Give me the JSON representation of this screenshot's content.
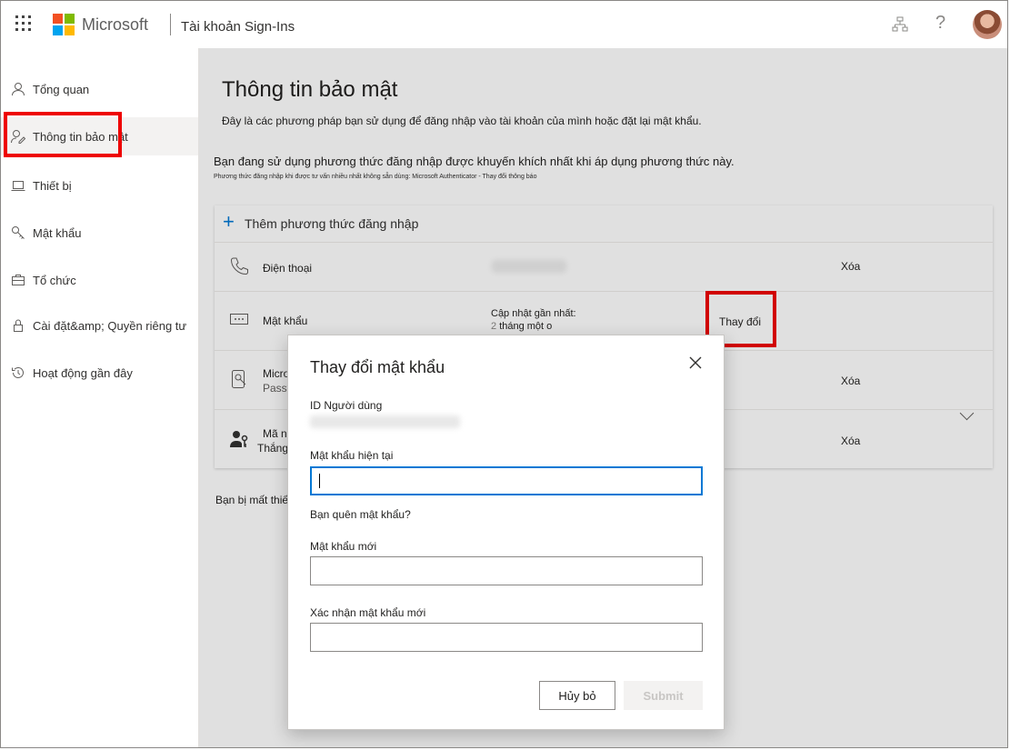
{
  "header": {
    "brand": "Microsoft",
    "app_title": "Tài khoản Sign-Ins",
    "help": "?"
  },
  "sidebar": {
    "items": [
      {
        "label": "Tổng quan",
        "icon": "person-icon"
      },
      {
        "label": "Thông tin bảo mật",
        "icon": "security-info-icon",
        "active": true
      },
      {
        "label": "Thiết bị",
        "icon": "laptop-icon"
      },
      {
        "label": "Mật khẩu",
        "icon": "key-icon"
      },
      {
        "label": "Tổ chức",
        "icon": "briefcase-icon"
      },
      {
        "label": "Cài đặt&amp; Quyền riêng tư",
        "icon": "lock-icon"
      },
      {
        "label": "Hoạt động gần đây",
        "icon": "history-icon"
      }
    ]
  },
  "main": {
    "title": "Thông tin bảo mật",
    "description": "Đây là các phương pháp bạn sử dụng để đăng nhập vào tài khoản của mình hoặc đặt lại mật khẩu.",
    "recommendation": "Bạn đang sử dụng phương thức đăng nhập được khuyến khích nhất khi áp dụng phương thức này.",
    "recommendation_sub": "Phương thức đăng nhập khi được tư vấn nhiều nhất không sẵn dùng: Microsoft Authenticator - Thay đổi thông báo",
    "add_method": "Thêm phương thức đăng nhập",
    "methods": [
      {
        "label": "Điện thoại",
        "action": "Xóa"
      },
      {
        "label": "Mật khẩu",
        "detail_title": "Cập nhật gần nhất:",
        "detail_number": "2",
        "detail_value": "tháng một o",
        "action": "Thay đổi"
      },
      {
        "label": "Micro",
        "sub": "Passv",
        "action": "Xóa"
      },
      {
        "label": "Mã na",
        "sub": "Thắng",
        "action": "Xóa"
      }
    ],
    "lost_device": "Bạn bị mất thiết bị?"
  },
  "dialog": {
    "title": "Thay đổi mật khẩu",
    "user_id_label": "ID Người dùng",
    "current_password_label": "Mật khẩu hiện tại",
    "current_password_value": "",
    "forgot_password": "Bạn quên mật khẩu?",
    "new_password_label": "Mật khẩu mới",
    "new_password_value": "",
    "confirm_password_label": "Xác nhận mật khẩu mới",
    "confirm_password_value": "",
    "cancel_label": "Hủy bỏ",
    "submit_label": "Submit"
  },
  "colors": {
    "accent": "#0078d4",
    "highlight": "#e00000",
    "ms_red": "#f25022",
    "ms_green": "#7fba00",
    "ms_blue": "#00a4ef",
    "ms_yellow": "#ffb900"
  }
}
